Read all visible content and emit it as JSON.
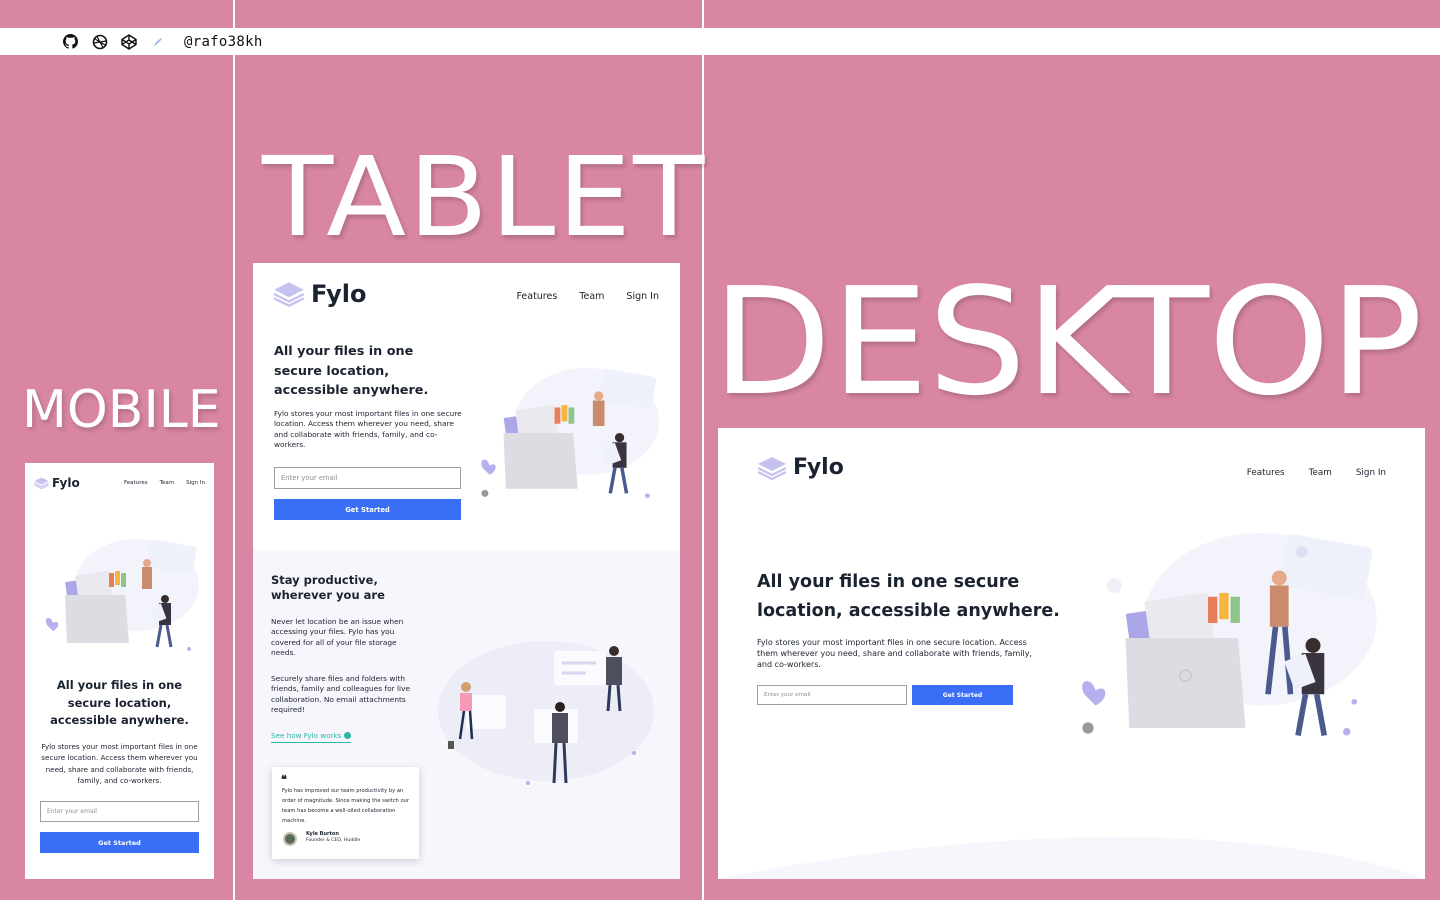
{
  "topbar": {
    "handle": "@rafo38kh"
  },
  "labels": {
    "mobile": "MOBILE",
    "tablet": "TABLET",
    "desktop": "DESKTOP"
  },
  "colors": {
    "background": "#d886a3",
    "accent": "#3b6ef6",
    "text": "#1b2330",
    "teal": "#2fb5a5"
  },
  "site": {
    "brand": "Fylo",
    "nav": [
      "Features",
      "Team",
      "Sign In"
    ],
    "hero": {
      "title": "All your files in one secure location, accessible anywhere.",
      "title_line1": "All your files in one secure",
      "title_line2": "location, accessible anywhere.",
      "body": "Fylo stores your most important files in one secure location. Access them wherever you need, share and collaborate with friends, family, and co-workers.",
      "email_placeholder": "Enter your email",
      "cta": "Get Started"
    },
    "productive": {
      "title": "Stay productive, wherever you are",
      "p1": "Never let location be an issue when accessing your files. Fylo has you covered for all of your file storage needs.",
      "p2": "Securely share files and folders with friends, family and colleagues for live collaboration. No email attachments required!",
      "link": "See how Fylo works"
    },
    "testimonial": {
      "quote": "Fylo has improved our team productivity by an order of magnitude. Since making the switch our team has become a well-oiled collaboration machine.",
      "name": "Kyle Burton",
      "role": "Founder & CEO, Huddle"
    }
  }
}
